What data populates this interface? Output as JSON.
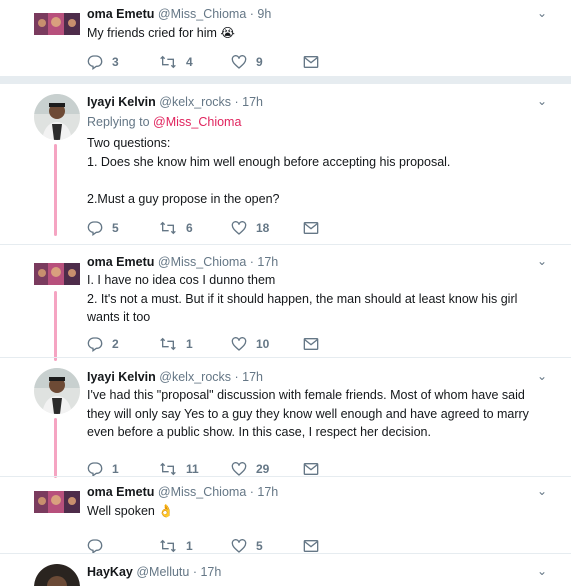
{
  "tweets": [
    {
      "name": "oma Emetu",
      "handle": "@Miss_Chioma",
      "time": "· 9h",
      "text": "My friends cried for him 😭",
      "replies": "3",
      "retweets": "4",
      "likes": "9"
    },
    {
      "name": "Iyayi Kelvin",
      "handle": "@kelx_rocks",
      "time": "· 17h",
      "reply_prefix": "Replying to ",
      "reply_to": "@Miss_Chioma",
      "text": "Two questions:\n1. Does she know him well enough before accepting his proposal.\n\n2.Must a guy propose in the open?",
      "replies": "5",
      "retweets": "6",
      "likes": "18"
    },
    {
      "name": "oma Emetu",
      "handle": "@Miss_Chioma",
      "time": "· 17h",
      "text": "I.  I have no idea cos I dunno them\n2. It's not a must.  But if it should happen, the man should at least know his girl\nwants it too",
      "replies": "2",
      "retweets": "1",
      "likes": "10"
    },
    {
      "name": "Iyayi Kelvin",
      "handle": "@kelx_rocks",
      "time": "· 17h",
      "text": "I've had this \"proposal\" discussion with female friends. Most of whom have said\nthey will only say Yes to a guy they know well enough and have agreed to marry\neven before a public show. In this case, I respect her decision.",
      "replies": "1",
      "retweets": "11",
      "likes": "29"
    },
    {
      "name": "oma Emetu",
      "handle": "@Miss_Chioma",
      "time": "· 17h",
      "text": "Well spoken 👌",
      "replies": "",
      "retweets": "1",
      "likes": "5"
    },
    {
      "name": "HayKay",
      "handle": "@Mellutu",
      "time": "· 17h"
    }
  ],
  "colors": {
    "accent": "#e0245e",
    "thread": "#f5a4c2",
    "muted": "#657786"
  },
  "icons": [
    "reply-icon",
    "retweet-icon",
    "like-icon",
    "message-icon",
    "chevron-down-icon"
  ]
}
